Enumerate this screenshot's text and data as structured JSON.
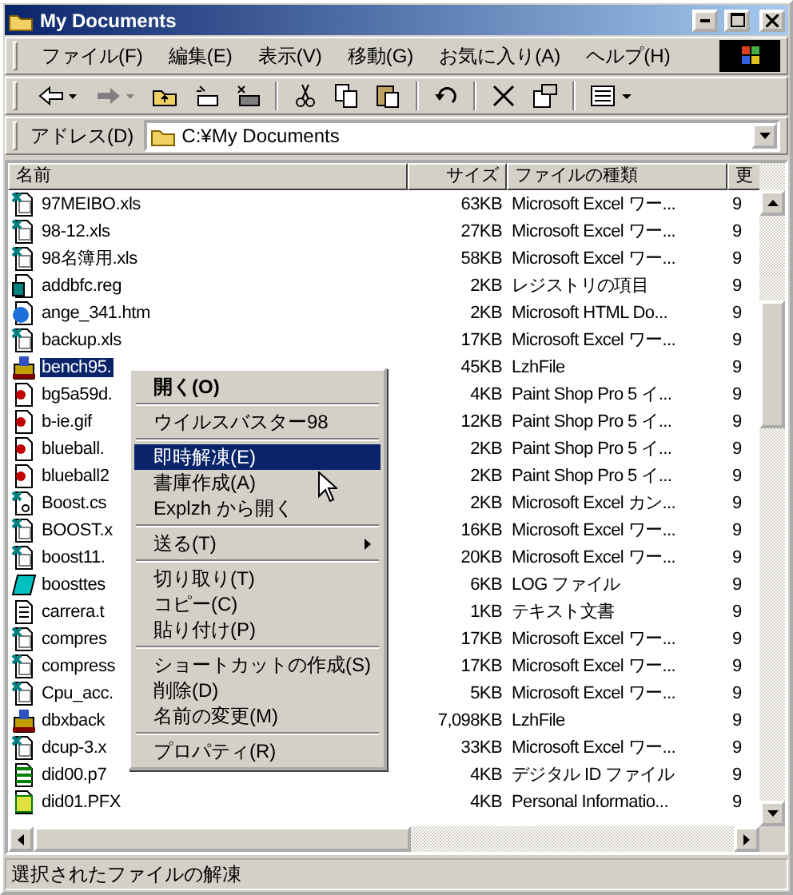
{
  "window": {
    "title": "My Documents"
  },
  "menu_bar": [
    "ファイル(F)",
    "編集(E)",
    "表示(V)",
    "移動(G)",
    "お気に入り(A)",
    "ヘルプ(H)"
  ],
  "address": {
    "label": "アドレス(D)",
    "value": "C:¥My Documents"
  },
  "table": {
    "columns": [
      "名前",
      "サイズ",
      "ファイルの種類",
      "更"
    ],
    "rows": [
      {
        "kind": "excel",
        "name": "97MEIBO.xls",
        "size": "63KB",
        "type": "Microsoft Excel ワー...",
        "date": "9",
        "selected": false
      },
      {
        "kind": "excel",
        "name": "98-12.xls",
        "size": "27KB",
        "type": "Microsoft Excel ワー...",
        "date": "9",
        "selected": false
      },
      {
        "kind": "excel",
        "name": "98名簿用.xls",
        "size": "58KB",
        "type": "Microsoft Excel ワー...",
        "date": "9",
        "selected": false
      },
      {
        "kind": "reg",
        "name": "addbfc.reg",
        "size": "2KB",
        "type": "レジストリの項目",
        "date": "9",
        "selected": false
      },
      {
        "kind": "html",
        "name": "ange_341.htm",
        "size": "2KB",
        "type": "Microsoft HTML Do...",
        "date": "9",
        "selected": false
      },
      {
        "kind": "excel",
        "name": "backup.xls",
        "size": "17KB",
        "type": "Microsoft Excel ワー...",
        "date": "9",
        "selected": false
      },
      {
        "kind": "lzh",
        "name": "bench95.",
        "size": "45KB",
        "type": "LzhFile",
        "date": "9",
        "selected": true
      },
      {
        "kind": "image",
        "name": "bg5a59d.",
        "size": "4KB",
        "type": "Paint Shop Pro 5 イ...",
        "date": "9",
        "selected": false
      },
      {
        "kind": "image",
        "name": "b-ie.gif",
        "size": "12KB",
        "type": "Paint Shop Pro 5 イ...",
        "date": "9",
        "selected": false
      },
      {
        "kind": "image",
        "name": "blueball.",
        "size": "2KB",
        "type": "Paint Shop Pro 5 イ...",
        "date": "9",
        "selected": false
      },
      {
        "kind": "image",
        "name": "blueball2",
        "size": "2KB",
        "type": "Paint Shop Pro 5 イ...",
        "date": "9",
        "selected": false
      },
      {
        "kind": "csv",
        "name": "Boost.cs",
        "size": "2KB",
        "type": "Microsoft Excel カン...",
        "date": "9",
        "selected": false
      },
      {
        "kind": "excel",
        "name": "BOOST.x",
        "size": "16KB",
        "type": "Microsoft Excel ワー...",
        "date": "9",
        "selected": false
      },
      {
        "kind": "excel",
        "name": "boost11.",
        "size": "20KB",
        "type": "Microsoft Excel ワー...",
        "date": "9",
        "selected": false
      },
      {
        "kind": "log",
        "name": "boosttes",
        "size": "6KB",
        "type": "LOG ファイル",
        "date": "9",
        "selected": false
      },
      {
        "kind": "text",
        "name": "carrera.t",
        "size": "1KB",
        "type": "テキスト文書",
        "date": "9",
        "selected": false
      },
      {
        "kind": "excel",
        "name": "compres",
        "size": "17KB",
        "type": "Microsoft Excel ワー...",
        "date": "9",
        "selected": false
      },
      {
        "kind": "excel",
        "name": "compress",
        "size": "17KB",
        "type": "Microsoft Excel ワー...",
        "date": "9",
        "selected": false
      },
      {
        "kind": "excel",
        "name": "Cpu_acc.",
        "size": "5KB",
        "type": "Microsoft Excel ワー...",
        "date": "9",
        "selected": false
      },
      {
        "kind": "lzh",
        "name": "dbxback",
        "size": "7,098KB",
        "type": "LzhFile",
        "date": "9",
        "selected": false
      },
      {
        "kind": "excel",
        "name": "dcup-3.x",
        "size": "33KB",
        "type": "Microsoft Excel ワー...",
        "date": "9",
        "selected": false
      },
      {
        "kind": "cert",
        "name": "did00.p7",
        "size": "4KB",
        "type": "デジタル ID ファイル",
        "date": "9",
        "selected": false
      },
      {
        "kind": "pfx",
        "name": "did01.PFX",
        "size": "4KB",
        "type": "Personal Informatio...",
        "date": "9",
        "selected": false
      }
    ]
  },
  "context_menu": [
    {
      "kind": "item",
      "label": "開く(O)",
      "bold": true,
      "selected": false
    },
    {
      "kind": "separator"
    },
    {
      "kind": "item",
      "label": "ウイルスバスター98",
      "selected": false
    },
    {
      "kind": "separator"
    },
    {
      "kind": "item",
      "label": "即時解凍(E)",
      "selected": true
    },
    {
      "kind": "item",
      "label": "書庫作成(A)",
      "selected": false
    },
    {
      "kind": "item",
      "label": "Explzh から開く",
      "selected": false
    },
    {
      "kind": "separator"
    },
    {
      "kind": "submenu",
      "label": "送る(T)",
      "selected": false
    },
    {
      "kind": "separator"
    },
    {
      "kind": "item",
      "label": "切り取り(T)",
      "selected": false
    },
    {
      "kind": "item",
      "label": "コピー(C)",
      "selected": false
    },
    {
      "kind": "item",
      "label": "貼り付け(P)",
      "selected": false
    },
    {
      "kind": "separator"
    },
    {
      "kind": "item",
      "label": "ショートカットの作成(S)",
      "selected": false
    },
    {
      "kind": "item",
      "label": "削除(D)",
      "selected": false
    },
    {
      "kind": "item",
      "label": "名前の変更(M)",
      "selected": false
    },
    {
      "kind": "separator"
    },
    {
      "kind": "item",
      "label": "プロパティ(R)",
      "selected": false
    }
  ],
  "status_bar": "選択されたファイルの解凍"
}
